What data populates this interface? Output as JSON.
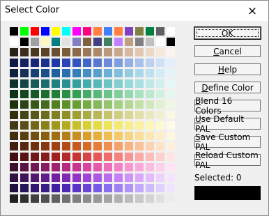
{
  "window": {
    "title": "Select Color"
  },
  "close_icon": "×",
  "buttons": [
    {
      "name": "ok-button",
      "label": "OK",
      "mnemonic_index": -1,
      "default": true
    },
    {
      "name": "cancel-button",
      "label": "Cancel",
      "mnemonic_index": 0,
      "default": false
    },
    {
      "name": "help-button",
      "label": "Help",
      "mnemonic_index": 0,
      "default": false
    },
    {
      "name": "define-color-button",
      "label": "Define Color",
      "mnemonic_index": 0,
      "default": false
    },
    {
      "name": "blend-16-colors-button",
      "label": "Blend 16 Colors",
      "mnemonic_index": 0,
      "default": false
    },
    {
      "name": "use-default-pal-button",
      "label": "Use Default PAL",
      "mnemonic_index": 0,
      "default": false
    },
    {
      "name": "save-custom-pal-button",
      "label": "Save Custom PAL",
      "mnemonic_index": 0,
      "default": false
    },
    {
      "name": "reload-custom-pal-button",
      "label": "Reload Custom PAL",
      "mnemonic_index": 0,
      "default": false
    }
  ],
  "selected": {
    "label": "Selected: 0",
    "color": "#000000"
  },
  "palette_rows": [
    [
      "#000000",
      "#00ff00",
      "#ff0000",
      "#0000ff",
      "#ffff00",
      "#00ffff",
      "#ff00ff",
      "#ff0080",
      "#ff8040",
      "#4080ff",
      "#ff8040",
      "#8040c0",
      "#808040",
      "#008040",
      "#606060",
      "#ffffff"
    ],
    [
      "#ffffff",
      "#000000",
      "#a0a0a0",
      "#fff8c0",
      "#008080",
      "#e0e0e0",
      "#8080c0",
      "#806040",
      "#404080",
      "#408060",
      "#c080ff",
      "#c0a080",
      "#808080",
      "#c0c0c0",
      "#ffffff",
      "#000000"
    ],
    [
      "#2a2218",
      "#3a2e1c",
      "#4a3820",
      "#5a4426",
      "#6a5030",
      "#7a5c3a",
      "#8a6a48",
      "#9a7858",
      "#aa8868",
      "#ba987a",
      "#c8a88c",
      "#d6b8a0",
      "#e2c8b2",
      "#ecd8c6",
      "#f4e8da",
      "#fbf4ee"
    ],
    [
      "#101848",
      "#142060",
      "#182878",
      "#1c3090",
      "#2038a8",
      "#2844b8",
      "#3454c0",
      "#4466c8",
      "#5878d0",
      "#6c8ad8",
      "#809ce0",
      "#94aee6",
      "#a8c0ec",
      "#bcd0f0",
      "#d0e0f6",
      "#e4eefa"
    ],
    [
      "#102040",
      "#143058",
      "#184070",
      "#1c5088",
      "#2060a0",
      "#2870b0",
      "#3480bc",
      "#4490c4",
      "#58a0cc",
      "#6cb0d4",
      "#80bedc",
      "#94cce2",
      "#a8d8ea",
      "#bce2f0",
      "#d0ecf6",
      "#e4f4fa"
    ],
    [
      "#103030",
      "#144444",
      "#185858",
      "#1c6c6c",
      "#208080",
      "#289090",
      "#34a0a0",
      "#44acac",
      "#58b8b8",
      "#6cc4c4",
      "#80cece",
      "#94d8d8",
      "#a8e0e0",
      "#bce8e8",
      "#d0f0f0",
      "#e4f8f8"
    ],
    [
      "#103018",
      "#144420",
      "#185828",
      "#1c6c30",
      "#208038",
      "#289044",
      "#34a054",
      "#44ac66",
      "#58b878",
      "#6cc48a",
      "#80ce9c",
      "#94d8ae",
      "#a8e0c0",
      "#bce8d0",
      "#d0f0e0",
      "#e4f8ee"
    ],
    [
      "#203010",
      "#2c4414",
      "#385818",
      "#446c1c",
      "#508020",
      "#5c9028",
      "#68a034",
      "#76ac44",
      "#84b858",
      "#94c46c",
      "#a4ce80",
      "#b4d894",
      "#c4e0a8",
      "#d2e8bc",
      "#e0f0d0",
      "#eef8e4"
    ],
    [
      "#303010",
      "#444414",
      "#585818",
      "#6c6c1c",
      "#808020",
      "#909028",
      "#a0a034",
      "#acac44",
      "#b8b858",
      "#c4c46c",
      "#cece80",
      "#d8d894",
      "#e0e0a8",
      "#e8e8bc",
      "#f0f0d0",
      "#f8f8e4"
    ],
    [
      "#403818",
      "#585018",
      "#706818",
      "#888018",
      "#a09818",
      "#b4ac20",
      "#c8c028",
      "#d8d030",
      "#e6dc40",
      "#eee458",
      "#f4ea70",
      "#f8ee88",
      "#faf2a0",
      "#fcf6b8",
      "#fdf9d0",
      "#fefce8"
    ],
    [
      "#403010",
      "#584010",
      "#705010",
      "#886010",
      "#a07010",
      "#b48018",
      "#c89020",
      "#d8a028",
      "#e6b038",
      "#eebe50",
      "#f4ca68",
      "#f8d480",
      "#fade98",
      "#fce6b0",
      "#fdeec8",
      "#fef6e0"
    ],
    [
      "#402010",
      "#582810",
      "#703010",
      "#883810",
      "#a04010",
      "#b44c18",
      "#c85a20",
      "#d86a28",
      "#e67c38",
      "#ee8e50",
      "#f4a068",
      "#f8b280",
      "#fac298",
      "#fcd2b0",
      "#fde2c8",
      "#fef0e0"
    ],
    [
      "#401010",
      "#581414",
      "#701818",
      "#881c1c",
      "#a02020",
      "#b42828",
      "#c83434",
      "#d84444",
      "#e65858",
      "#ee6c6c",
      "#f48080",
      "#f89494",
      "#faa8a8",
      "#fcbcbc",
      "#fdd0d0",
      "#fee4e4"
    ],
    [
      "#401030",
      "#581440",
      "#701850",
      "#881c60",
      "#a02070",
      "#b42880",
      "#c83490",
      "#d8449e",
      "#e658ac",
      "#ee6cb8",
      "#f480c4",
      "#f894ce",
      "#faa8d8",
      "#fcbce2",
      "#fdd0ec",
      "#fee4f6"
    ],
    [
      "#301040",
      "#401458",
      "#501870",
      "#601c88",
      "#7020a0",
      "#8028b4",
      "#9034c8",
      "#9e44d8",
      "#ac58e6",
      "#b86cee",
      "#c480f4",
      "#ce94f8",
      "#d8a8fa",
      "#e2bcfc",
      "#ecd0fd",
      "#f6e4fe"
    ],
    [
      "#201040",
      "#281458",
      "#301870",
      "#381c88",
      "#4020a0",
      "#4c28b4",
      "#5834c8",
      "#6844d8",
      "#7858e6",
      "#8a6cee",
      "#9c80f4",
      "#ae94f8",
      "#c0a8fa",
      "#d0bcfc",
      "#e0d0fd",
      "#f0e4fe"
    ],
    [
      "#202020",
      "#303030",
      "#404040",
      "#505050",
      "#606060",
      "#707070",
      "#808080",
      "#8c8c8c",
      "#989898",
      "#a4a4a4",
      "#b0b0b0",
      "#bcbcbc",
      "#c8c8c8",
      "#d4d4d4",
      "#e0e0e0",
      "#ececec"
    ]
  ]
}
